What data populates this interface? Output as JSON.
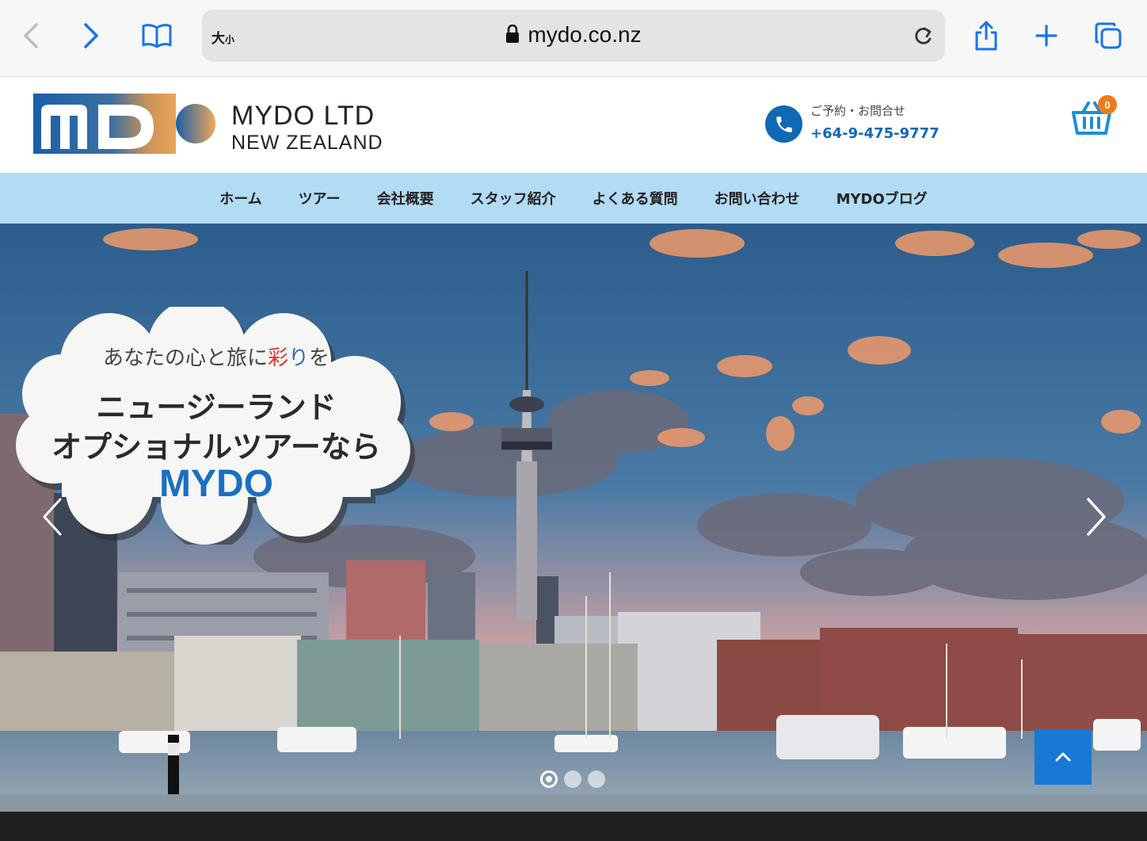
{
  "browser": {
    "text_size_label": "大",
    "text_size_small": "小",
    "url": "mydo.co.nz"
  },
  "header": {
    "brand_line1": "MYDO LTD",
    "brand_line2": "NEW ZEALAND",
    "contact_label": "ご予約・お問合せ",
    "phone": "+64-9-475-9777",
    "cart_count": "0"
  },
  "nav": {
    "items": [
      {
        "label": "ホーム"
      },
      {
        "label": "ツアー"
      },
      {
        "label": "会社概要"
      },
      {
        "label": "スタッフ紹介"
      },
      {
        "label": "よくある質問"
      },
      {
        "label": "お問い合わせ"
      },
      {
        "label": "MYDOブログ"
      }
    ]
  },
  "hero": {
    "tagline_a": "あなたの心と旅に",
    "tagline_r1": "彩",
    "tagline_r2": "り",
    "tagline_b": "を",
    "headline1": "ニュージーランド",
    "headline2": "オプショナルツアーなら",
    "brand": "MYDO",
    "slide_count": 3,
    "active_slide": 1
  },
  "colors": {
    "accent_blue": "#1168b5",
    "nav_bg": "#b2dbf4",
    "cart_badge": "#f07b16",
    "to_top_button": "#1779d3"
  },
  "icons": [
    "back-icon",
    "forward-icon",
    "bookmarks-icon",
    "lock-icon",
    "reload-icon",
    "share-icon",
    "new-tab-icon",
    "tabs-icon",
    "phone-icon",
    "cart-icon",
    "chevron-left-icon",
    "chevron-right-icon",
    "chevron-up-icon"
  ]
}
